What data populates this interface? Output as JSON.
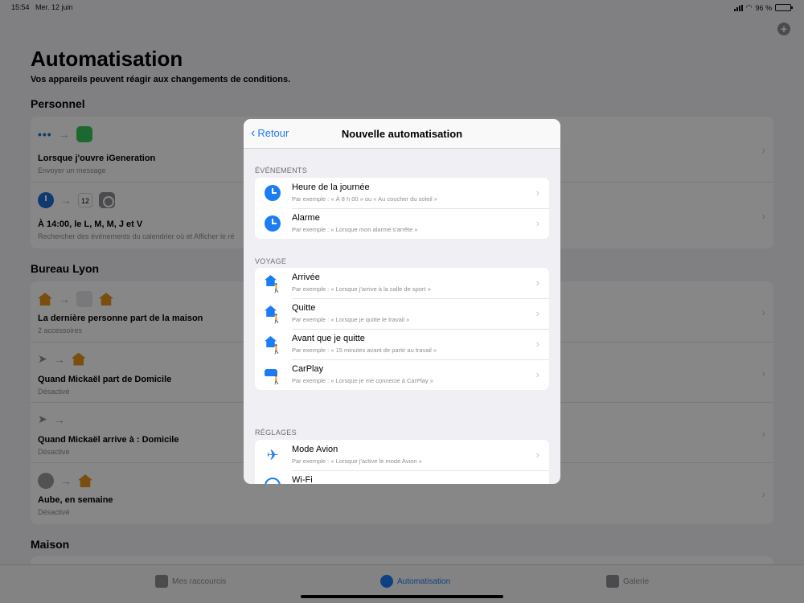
{
  "status_bar": {
    "time": "15:54",
    "date": "Mer. 12 juin",
    "battery": "96 %",
    "battery_level": 0.96
  },
  "page": {
    "title": "Automatisation",
    "subtitle": "Vos appareils peuvent réagir aux changements de conditions."
  },
  "sections": {
    "personnel": {
      "heading": "Personnel",
      "rows": [
        {
          "title": "Lorsque j'ouvre iGeneration",
          "subtitle": "Envoyer un message"
        },
        {
          "title": "À 14:00, le L, M, M, J et V",
          "subtitle": "Rechercher des événements du calendrier où et Afficher le ré",
          "cal_day": "12"
        }
      ]
    },
    "bureau": {
      "heading": "Bureau Lyon",
      "rows": [
        {
          "title": "La dernière personne part de la maison",
          "subtitle": "2 accessoires"
        },
        {
          "title": "Quand Mickaël part de Domicile",
          "subtitle": "Désactivé"
        },
        {
          "title": "Quand Mickaël arrive à : Domicile",
          "subtitle": "Désactivé"
        },
        {
          "title": "Aube, en semaine",
          "subtitle": "Désactivé"
        }
      ]
    },
    "maison": {
      "heading": "Maison"
    }
  },
  "tabbar": {
    "tabs": [
      {
        "label": "Mes raccourcis"
      },
      {
        "label": "Automatisation"
      },
      {
        "label": "Galerie"
      }
    ]
  },
  "modal": {
    "back_label": "Retour",
    "title": "Nouvelle automatisation",
    "groups": [
      {
        "label": "ÉVÉNEMENTS",
        "items": [
          {
            "title": "Heure de la journée",
            "subtitle": "Par exemple : « À 8 h 00 » ou « Au coucher du soleil »"
          },
          {
            "title": "Alarme",
            "subtitle": "Par exemple : « Lorsque mon alarme s'arrête »"
          }
        ]
      },
      {
        "label": "VOYAGE",
        "items": [
          {
            "title": "Arrivée",
            "subtitle": "Par exemple : « Lorsque j'arrive à la salle de sport »"
          },
          {
            "title": "Quitte",
            "subtitle": "Par exemple : « Lorsque je quitte le travail »"
          },
          {
            "title": "Avant que je quitte",
            "subtitle": "Par exemple : « 15 minutes avant de partir au travail »"
          },
          {
            "title": "CarPlay",
            "subtitle": "Par exemple : « Lorsque je me connecte à CarPlay »"
          }
        ]
      },
      {
        "label": "RÉGLAGES",
        "items": [
          {
            "title": "Mode Avion",
            "subtitle": "Par exemple : « Lorsque j'active le mode Avion »"
          },
          {
            "title": "Wi-Fi",
            "subtitle": ""
          }
        ]
      }
    ]
  },
  "colors": {
    "accent": "#1c7cf4",
    "home_accent": "#e6941d",
    "message_green": "#34c759"
  }
}
